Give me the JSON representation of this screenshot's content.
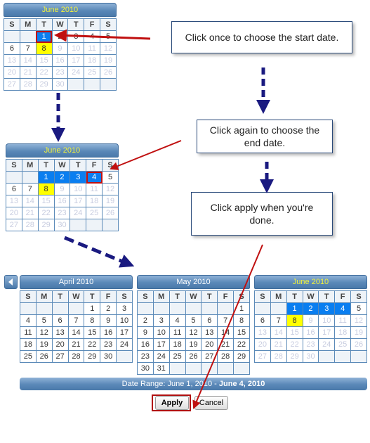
{
  "weekdays": [
    "S",
    "M",
    "T",
    "W",
    "T",
    "F",
    "S"
  ],
  "calendars": [
    {
      "id": "step1-june",
      "title": "June 2010",
      "current": true,
      "start": 2,
      "days": 30,
      "trailing_empty": 3,
      "selected": [
        1
      ],
      "outlined": [
        1
      ],
      "today": 8,
      "disabled_from": 9
    },
    {
      "id": "step2-june",
      "title": "June 2010",
      "current": true,
      "start": 2,
      "days": 30,
      "trailing_empty": 3,
      "selected": [
        1,
        2,
        3,
        4
      ],
      "outlined": [
        4
      ],
      "today": 8,
      "disabled_from": 9
    },
    {
      "id": "april",
      "title": "April 2010",
      "current": false,
      "start": 4,
      "days": 30,
      "trailing_empty": 1,
      "selected": [],
      "outlined": [],
      "today": null,
      "disabled_from": null
    },
    {
      "id": "may",
      "title": "May 2010",
      "current": false,
      "start": 6,
      "days": 31,
      "trailing_empty": 5,
      "selected": [],
      "outlined": [],
      "today": null,
      "disabled_from": null
    },
    {
      "id": "june",
      "title": "June 2010",
      "current": true,
      "start": 2,
      "days": 30,
      "trailing_empty": 3,
      "selected": [
        1,
        2,
        3,
        4
      ],
      "outlined": [],
      "today": 8,
      "disabled_from": 9
    }
  ],
  "callouts": [
    "Click once to choose the start date.",
    "Click again to choose the end date.",
    "Click apply when you're done."
  ],
  "date_range": {
    "label": "Date Range: June 1, 2010 - ",
    "end": "June 4, 2010"
  },
  "buttons": {
    "apply": "Apply",
    "cancel": "Cancel"
  },
  "icons": {
    "back": "chevron-left-icon"
  },
  "colors": {
    "selected": "#0a7ef0",
    "today": "#ffff00",
    "header": "#5a88b8",
    "highlight": "#c01010",
    "arrow_blue": "#1a1a80"
  }
}
